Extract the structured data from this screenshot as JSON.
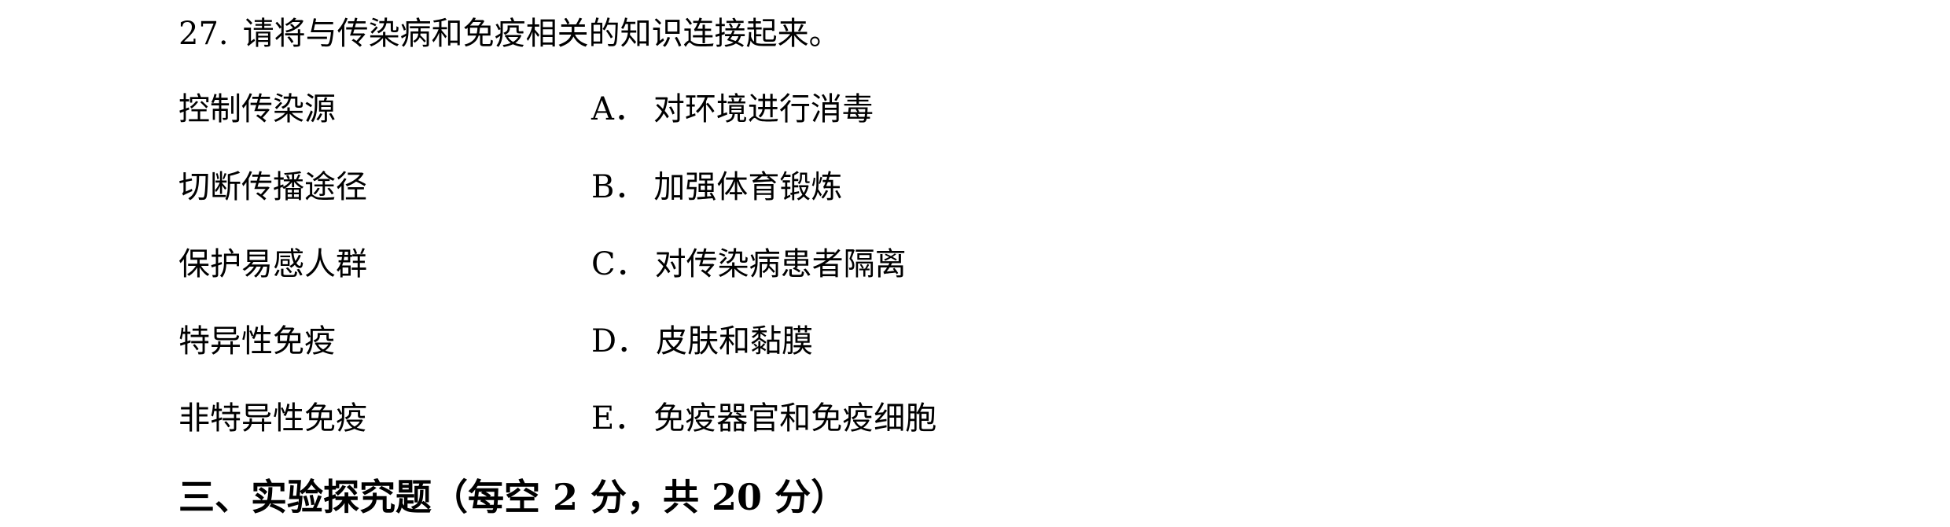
{
  "question": {
    "number": "27.",
    "text": "请将与传染病和免疫相关的知识连接起来。"
  },
  "left_items": [
    "控制传染源",
    "切断传播途径",
    "保护易感人群",
    "特异性免疫",
    "非特异性免疫"
  ],
  "right_items": [
    {
      "letter": "A．",
      "text": "对环境进行消毒"
    },
    {
      "letter": "B．",
      "text": "加强体育锻炼"
    },
    {
      "letter": "C．",
      "text": "对传染病患者隔离"
    },
    {
      "letter": "D．",
      "text": "皮肤和黏膜"
    },
    {
      "letter": "E．",
      "text": "免疫器官和免疫细胞"
    }
  ],
  "section_heading": "三、实验探究题（每空 2 分，共 20 分）"
}
